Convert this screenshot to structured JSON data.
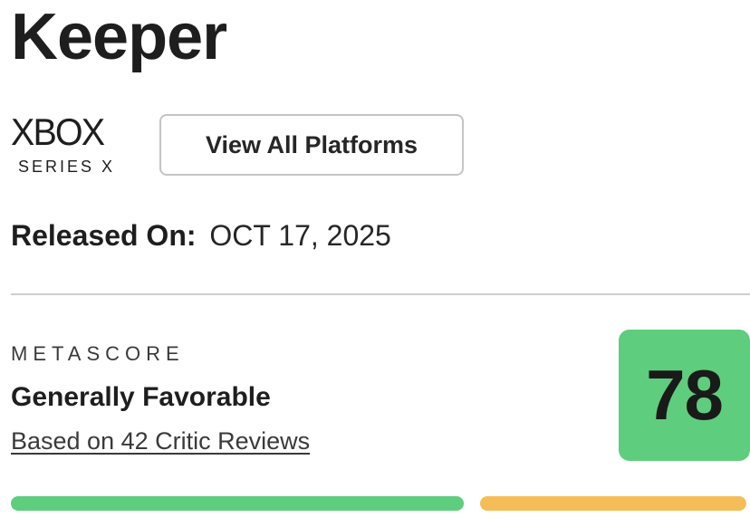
{
  "game": {
    "title": "Keeper"
  },
  "platform": {
    "name": "XBOX",
    "subtitle": "SERIES X",
    "view_all_label": "View All Platforms"
  },
  "release": {
    "label": "Released On:",
    "date": "OCT 17, 2025"
  },
  "metascore": {
    "label": "METASCORE",
    "sentiment": "Generally Favorable",
    "reviews_link": "Based on 42 Critic Reviews",
    "score": "78",
    "score_color": "#5fcd7e"
  },
  "review_distribution": [
    {
      "sentiment": "positive",
      "share": 0.63,
      "color": "#5fcd7e"
    },
    {
      "sentiment": "mixed",
      "share": 0.37,
      "color": "#f4bd58"
    }
  ]
}
